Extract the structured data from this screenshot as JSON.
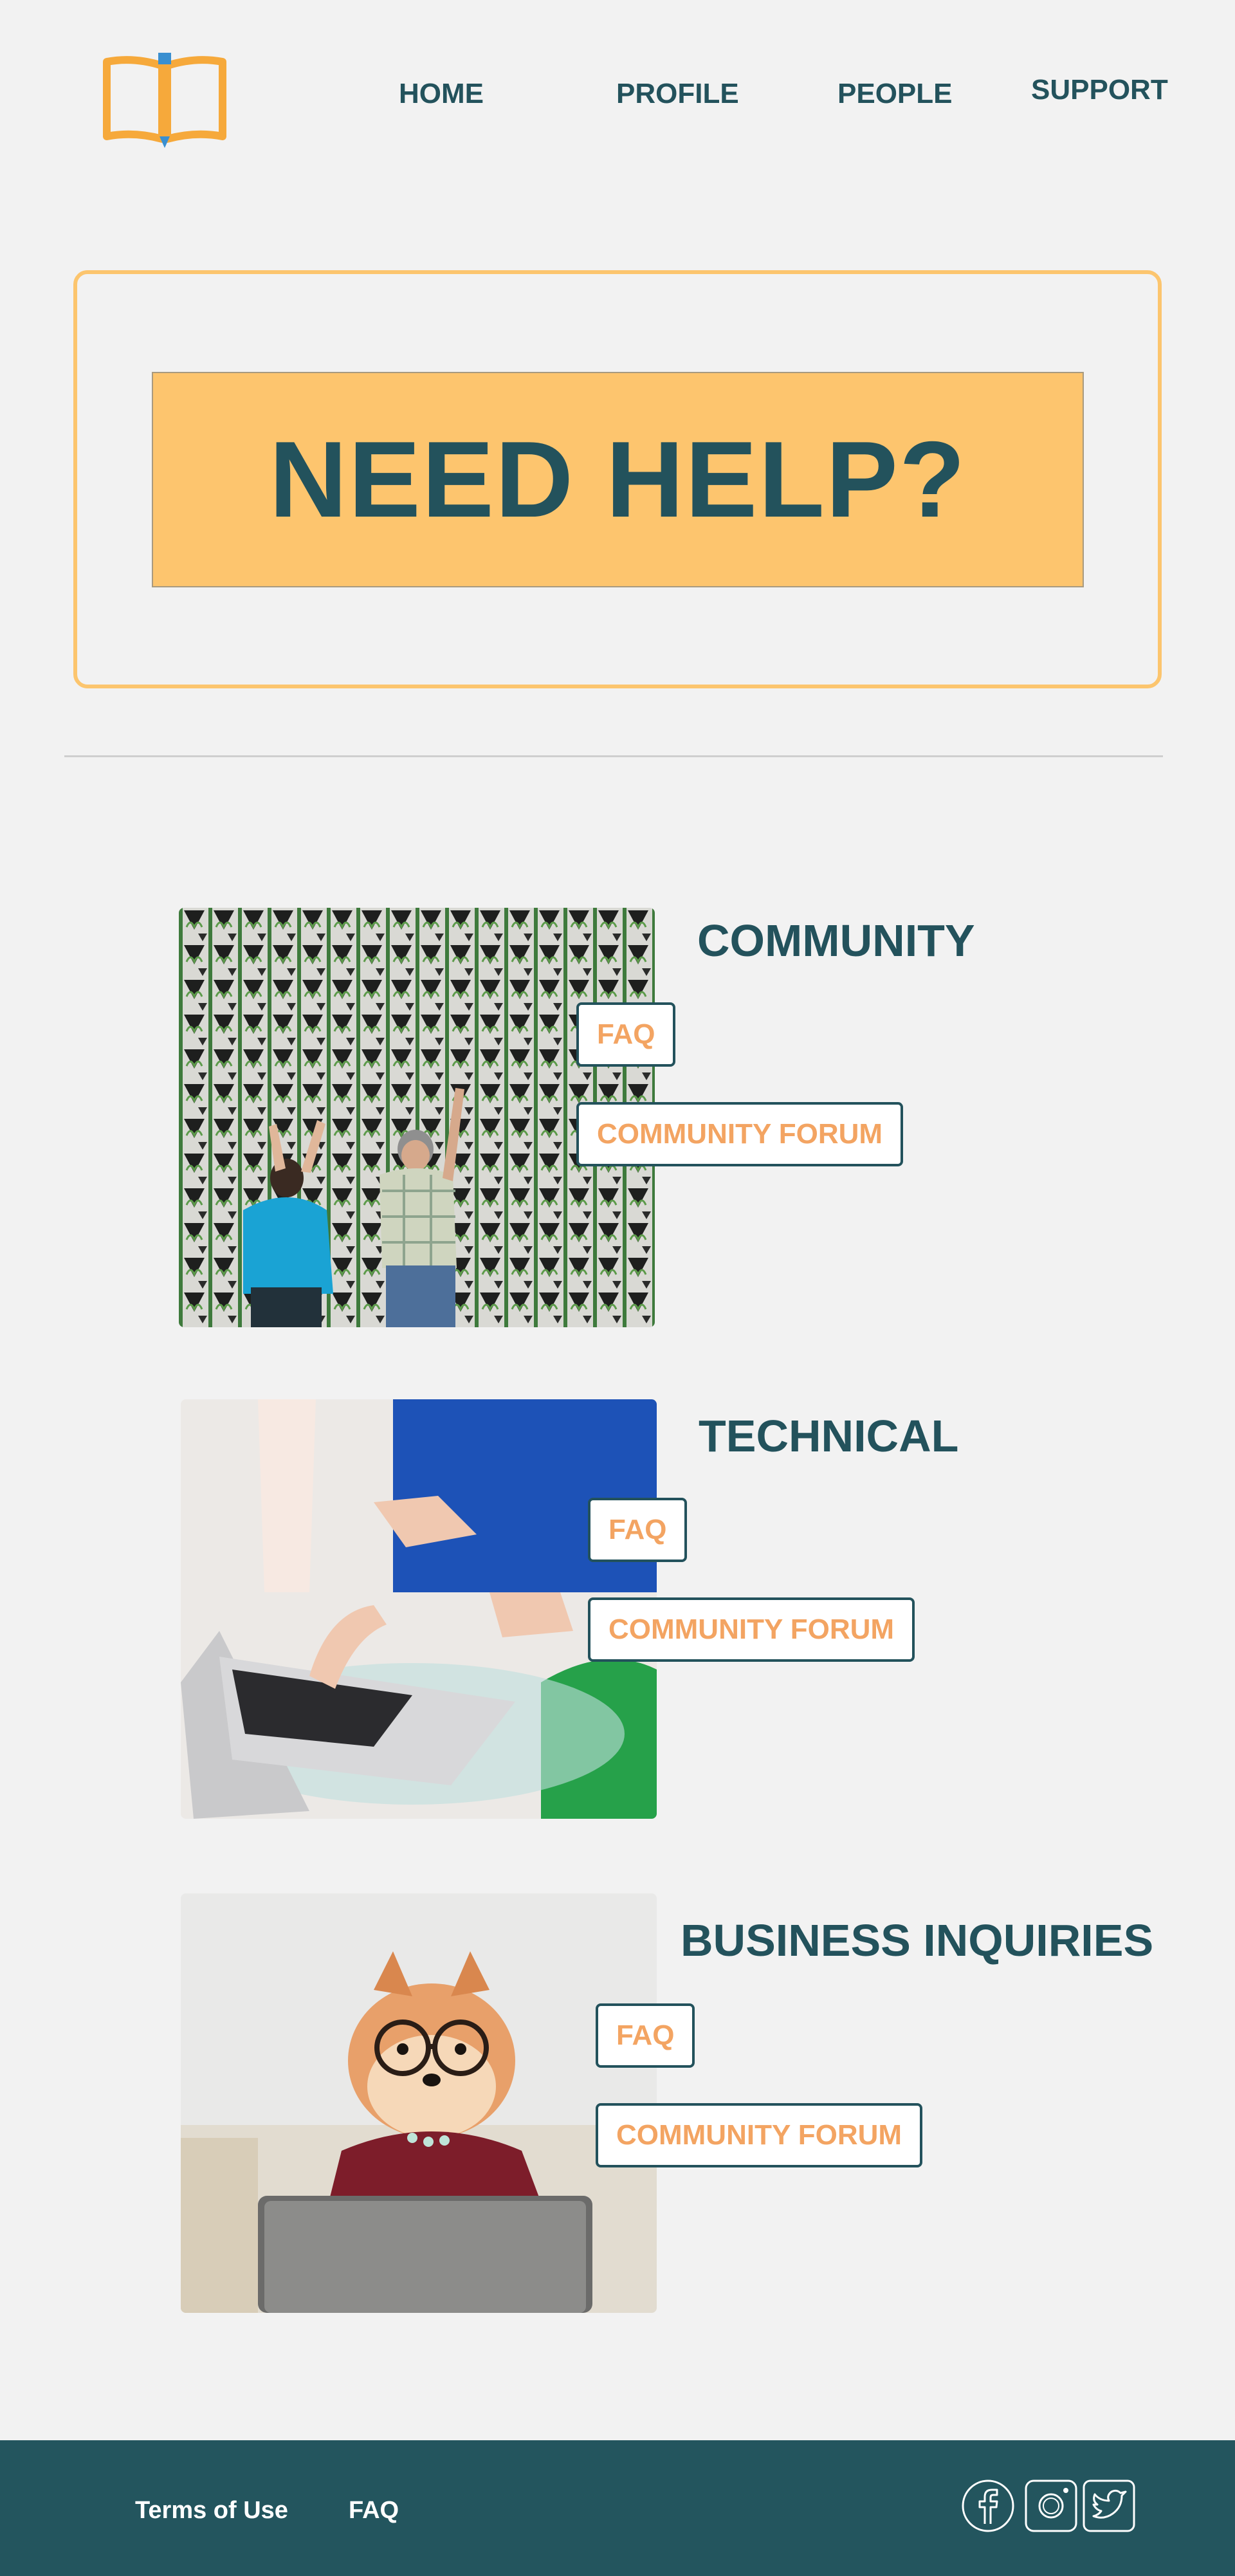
{
  "nav": {
    "home": "HOME",
    "profile": "PROFILE",
    "people": "PEOPLE",
    "support": "SUPPORT"
  },
  "hero": {
    "title": "NEED HELP?"
  },
  "sections": [
    {
      "title": "COMMUNITY",
      "faq": "FAQ",
      "forum": "COMMUNITY FORUM",
      "photo": "people-planting-wall-photo"
    },
    {
      "title": "TECHNICAL",
      "faq": "FAQ",
      "forum": "COMMUNITY FORUM",
      "photo": "laptop-meeting-photo"
    },
    {
      "title": "BUSINESS INQUIRIES",
      "faq": "FAQ",
      "forum": "COMMUNITY FORUM",
      "photo": "dog-with-glasses-photo"
    }
  ],
  "footer": {
    "terms": "Terms of Use",
    "faq": "FAQ",
    "social": [
      "facebook-icon",
      "instagram-icon",
      "twitter-icon"
    ]
  },
  "colors": {
    "primary": "#23525c",
    "accent": "#fdc56e",
    "button_text": "#f3a462",
    "background": "#f2f2f2",
    "footer": "#23555e"
  }
}
